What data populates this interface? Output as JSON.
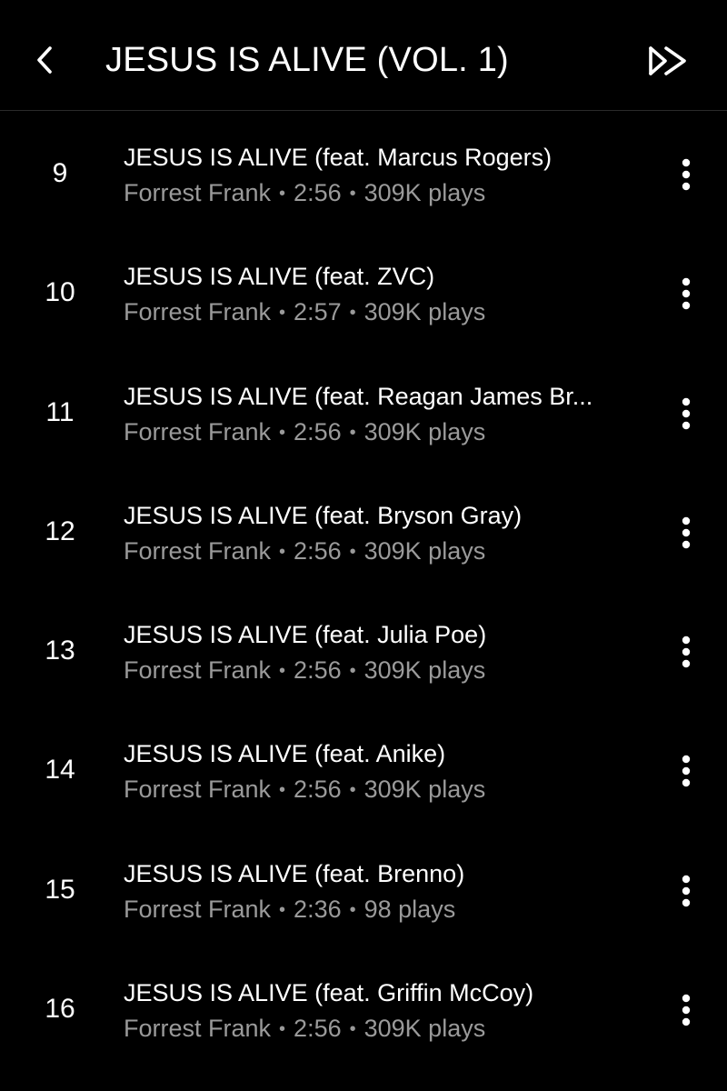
{
  "header": {
    "title": "JESUS IS ALIVE (VOL. 1)",
    "back_icon": "chevron-left-icon",
    "next_icon": "double-chevron-right-icon"
  },
  "tracks": [
    {
      "number": "9",
      "title": "JESUS IS ALIVE (feat. Marcus Rogers)",
      "artist": "Forrest Frank",
      "duration": "2:56",
      "plays": "309K plays"
    },
    {
      "number": "10",
      "title": "JESUS IS ALIVE (feat. ZVC)",
      "artist": "Forrest Frank",
      "duration": "2:57",
      "plays": "309K plays"
    },
    {
      "number": "11",
      "title": "JESUS IS ALIVE (feat. Reagan James Br...",
      "artist": "Forrest Frank",
      "duration": "2:56",
      "plays": "309K plays"
    },
    {
      "number": "12",
      "title": "JESUS IS ALIVE (feat. Bryson Gray)",
      "artist": "Forrest Frank",
      "duration": "2:56",
      "plays": "309K plays"
    },
    {
      "number": "13",
      "title": "JESUS IS ALIVE (feat. Julia Poe)",
      "artist": "Forrest Frank",
      "duration": "2:56",
      "plays": "309K plays"
    },
    {
      "number": "14",
      "title": "JESUS IS ALIVE (feat. Anike)",
      "artist": "Forrest Frank",
      "duration": "2:56",
      "plays": "309K plays"
    },
    {
      "number": "15",
      "title": "JESUS IS ALIVE (feat. Brenno)",
      "artist": "Forrest Frank",
      "duration": "2:36",
      "plays": "98 plays"
    },
    {
      "number": "16",
      "title": "JESUS IS ALIVE (feat. Griffin McCoy)",
      "artist": "Forrest Frank",
      "duration": "2:56",
      "plays": "309K plays"
    }
  ],
  "separator": "•",
  "more_icon": "vertical-ellipsis-icon",
  "colors": {
    "background": "#000000",
    "primary_text": "#ffffff",
    "secondary_text": "#9a9a9a",
    "divider": "#2a2a2a"
  }
}
